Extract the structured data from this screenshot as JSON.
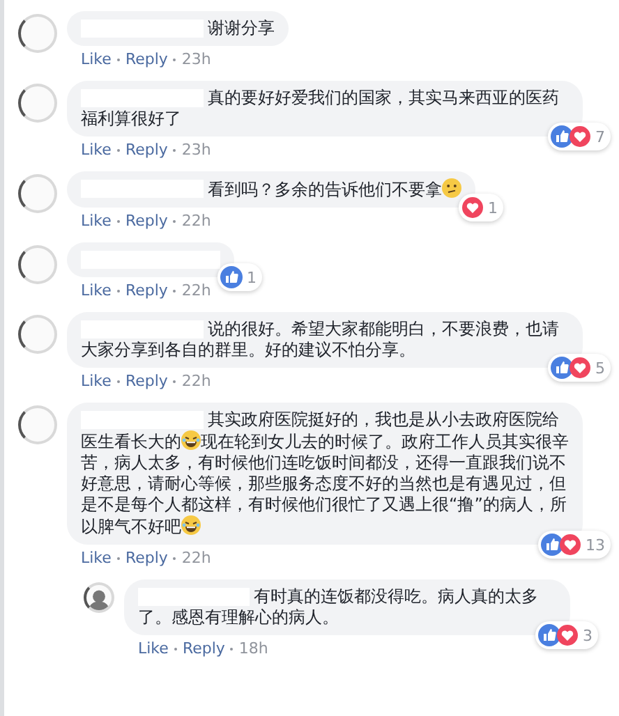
{
  "comments": [
    {
      "body": [
        {
          "kind": "text",
          "text": "谢谢分享"
        }
      ],
      "actions": [
        "Like",
        "Reply"
      ],
      "time": "23h",
      "reply": false
    },
    {
      "body": [
        {
          "kind": "text",
          "text": "真的要好好爱我们的国家，其实马来西亚的医药福利算很好了"
        }
      ],
      "actions": [
        "Like",
        "Reply"
      ],
      "time": "23h",
      "reply": false,
      "reactions": {
        "types": [
          {
            "kind": "like"
          },
          {
            "kind": "love"
          }
        ],
        "count": "7"
      }
    },
    {
      "body": [
        {
          "kind": "text",
          "text": "看到吗？多余的告诉他们不要拿"
        },
        {
          "kind": "confused_emoji"
        }
      ],
      "actions": [
        "Like",
        "Reply"
      ],
      "time": "22h",
      "reply": false,
      "reactions": {
        "types": [
          {
            "kind": "love"
          }
        ],
        "count": "1"
      }
    },
    {
      "actions": [
        "Like",
        "Reply"
      ],
      "time": "22h",
      "reply": false,
      "reactions": {
        "types": [
          {
            "kind": "like"
          }
        ],
        "count": "1"
      }
    },
    {
      "body": [
        {
          "kind": "text",
          "text": "说的很好。希望大家都能明白，不要浪费，也请大家分享到各自的群里。好的建议不怕分享。"
        }
      ],
      "actions": [
        "Like",
        "Reply"
      ],
      "time": "22h",
      "reply": false,
      "reactions": {
        "types": [
          {
            "kind": "like"
          },
          {
            "kind": "love"
          }
        ],
        "count": "5"
      }
    },
    {
      "body": [
        {
          "kind": "text",
          "text": "其实政府医院挺好的，我也是从小去政府医院给医生看长大的"
        },
        {
          "kind": "laughing_emoji"
        },
        {
          "kind": "text",
          "text": "现在轮到女儿去的时候了。政府工作人员其实很辛苦，病人太多，有时候他们连吃饭时间都没，还得一直跟我们说不好意思，请耐心等候，那些服务态度不好的当然也是有遇见过，但是不是每个人都这样，有时候他们很忙了又遇上很“撸”的病人，所以脾气不好吧"
        },
        {
          "kind": "laughing_emoji"
        }
      ],
      "actions": [
        "Like",
        "Reply"
      ],
      "time": "22h",
      "reply": false,
      "reactions": {
        "types": [
          {
            "kind": "like"
          },
          {
            "kind": "love"
          }
        ],
        "count": "13"
      }
    },
    {
      "body": [
        {
          "kind": "text",
          "text": "有时真的连饭都没得吃。病人真的太多了。感恩有理解心的病人。"
        }
      ],
      "actions": [
        "Like",
        "Reply"
      ],
      "time": "18h",
      "reply": true,
      "reactions": {
        "types": [
          {
            "kind": "like"
          },
          {
            "kind": "love"
          }
        ],
        "count": "3"
      }
    }
  ]
}
